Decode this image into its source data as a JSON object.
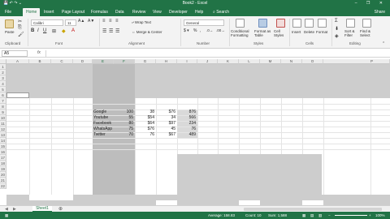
{
  "window": {
    "title": "Book2 - Excel",
    "controls": "– ❐ ✕",
    "quick_access": "💾 ↶ ↷ ⌄"
  },
  "tabs": [
    "File",
    "Home",
    "Insert",
    "Page Layout",
    "Formulas",
    "Data",
    "Review",
    "View",
    "Developer",
    "Help"
  ],
  "tell_me": "Search",
  "sign_in": "Share",
  "ribbon": {
    "paste": "Paste",
    "clipboard": "Clipboard",
    "font_name": "Calibri",
    "font_size": "11",
    "font": "Font",
    "wrap_text": "Wrap Text",
    "merge_center": "Merge & Center",
    "alignment": "Alignment",
    "number_format": "General",
    "number": "Number",
    "conditional_formatting": "Conditional Formatting",
    "format_as_table": "Format as Table",
    "cell_styles": "Cell Styles",
    "styles": "Styles",
    "insert": "Insert",
    "delete": "Delete",
    "format": "Format",
    "cells": "Cells",
    "sort_filter": "Sort & Filter",
    "find_select": "Find & Select",
    "editing": "Editing"
  },
  "formula_bar": {
    "name_box": "A5",
    "fx": "fx"
  },
  "grid": {
    "columns": [
      "A",
      "B",
      "C",
      "D",
      "E",
      "F",
      "G",
      "H",
      "I",
      "J",
      "K",
      "L",
      "M",
      "N",
      "O",
      "P"
    ],
    "rows": [
      "1",
      "2",
      "3",
      "4",
      "5",
      "6",
      "7",
      "8",
      "9",
      "10",
      "11",
      "12",
      "13",
      "14",
      "15",
      "16",
      "17",
      "18",
      "19",
      "20",
      "21",
      "22"
    ],
    "data": [
      {
        "name": "Google",
        "v1": "100",
        "v2": "38",
        "v3": "$76",
        "v4": "876"
      },
      {
        "name": "Youtube",
        "v1": "55",
        "v2": "$54",
        "v3": "34",
        "v4": "566"
      },
      {
        "name": "Facebook",
        "v1": "80",
        "v2": "$64",
        "v3": "$97",
        "v4": "234"
      },
      {
        "name": "WhatsApp",
        "v1": "75",
        "v2": "$76",
        "v3": "45",
        "v4": "76"
      },
      {
        "name": "Twitter",
        "v1": "70",
        "v2": "76",
        "v3": "$67",
        "v4": "489"
      }
    ]
  },
  "sheet_tabs": {
    "active": "Sheet1",
    "add": "⊕"
  },
  "status": {
    "average": "Average: 158.83",
    "count": "Count: 10",
    "sum": "Sum: 1,588",
    "zoom": "100%"
  },
  "colors": {
    "accent": "#217346",
    "selection_fill": "#cdcdcd"
  }
}
